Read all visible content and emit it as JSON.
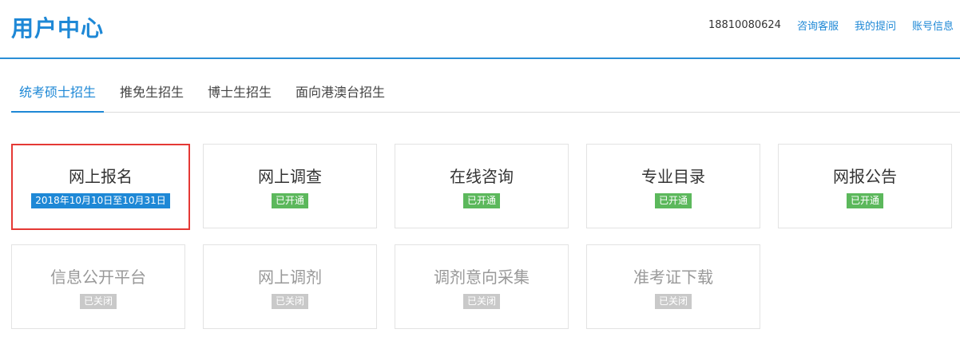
{
  "header": {
    "logo": "用户中心",
    "phone": "18810080624",
    "links": [
      "咨询客服",
      "我的提问",
      "账号信息"
    ]
  },
  "tabs": [
    "统考硕士招生",
    "推免生招生",
    "博士生招生",
    "面向港澳台招生"
  ],
  "cards": [
    {
      "title": "网上报名",
      "status": "2018年10月10日至10月31日",
      "state": "date"
    },
    {
      "title": "网上调查",
      "status": "已开通",
      "state": "open"
    },
    {
      "title": "在线咨询",
      "status": "已开通",
      "state": "open"
    },
    {
      "title": "专业目录",
      "status": "已开通",
      "state": "open"
    },
    {
      "title": "网报公告",
      "status": "已开通",
      "state": "open"
    },
    {
      "title": "信息公开平台",
      "status": "已关闭",
      "state": "closed"
    },
    {
      "title": "网上调剂",
      "status": "已关闭",
      "state": "closed"
    },
    {
      "title": "调剂意向采集",
      "status": "已关闭",
      "state": "closed"
    },
    {
      "title": "准考证下载",
      "status": "已关闭",
      "state": "closed"
    }
  ],
  "colors": {
    "accent": "#1e88d6",
    "open_badge": "#5cb85c",
    "closed_badge": "#c9c9c9",
    "highlight_border": "#e53935"
  }
}
